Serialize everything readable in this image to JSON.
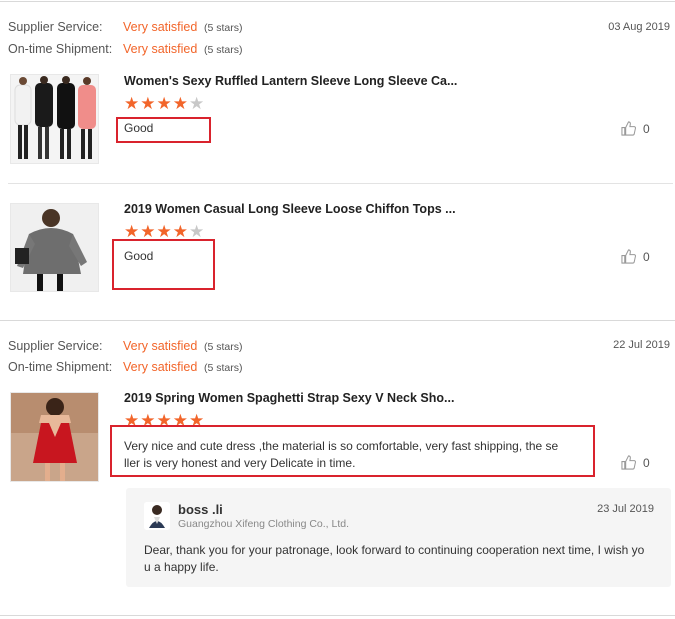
{
  "reviews": [
    {
      "supplier_label": "Supplier Service:",
      "supplier_value": "Very satisfied",
      "supplier_stars": "(5 stars)",
      "shipment_label": "On-time Shipment:",
      "shipment_value": "Very satisfied",
      "shipment_stars": "(5 stars)",
      "date": "03 Aug 2019",
      "items": [
        {
          "title": "Women's Sexy Ruffled Lantern Sleeve Long Sleeve Ca...",
          "rating": 4,
          "text": "Good",
          "likes": "0",
          "thumb_icon": "product-photo-ruffled-tops"
        },
        {
          "title": "2019 Women Casual Long Sleeve Loose Chiffon Tops ...",
          "rating": 4,
          "text": "Good",
          "likes": "0",
          "thumb_icon": "product-photo-chiffon-top"
        }
      ]
    },
    {
      "supplier_label": "Supplier Service:",
      "supplier_value": "Very satisfied",
      "supplier_stars": "(5 stars)",
      "shipment_label": "On-time Shipment:",
      "shipment_value": "Very satisfied",
      "shipment_stars": "(5 stars)",
      "date": "22 Jul 2019",
      "items": [
        {
          "title": "2019 Spring Women Spaghetti Strap Sexy V Neck Sho...",
          "rating": 5,
          "text_line1": "Very nice and cute dress ,the material is so comfortable, very fast shipping, the se",
          "text_line2": "ller is very honest and very Delicate in time.",
          "likes": "0",
          "thumb_icon": "product-photo-red-dress"
        }
      ],
      "reply": {
        "name": "boss .li",
        "company": "Guangzhou Xifeng Clothing Co., Ltd.",
        "date": "23 Jul 2019",
        "line1": "Dear, thank you for your patronage, look forward to continuing cooperation next time, I wish yo",
        "line2": "u a happy life."
      }
    }
  ],
  "colors": {
    "accent": "#f2652a",
    "highlight_box": "#d9232d",
    "reply_bg": "#f5f5f5"
  },
  "icons": {
    "like": "thumbs-up-icon",
    "star": "star-icon",
    "avatar": "seller-avatar"
  }
}
